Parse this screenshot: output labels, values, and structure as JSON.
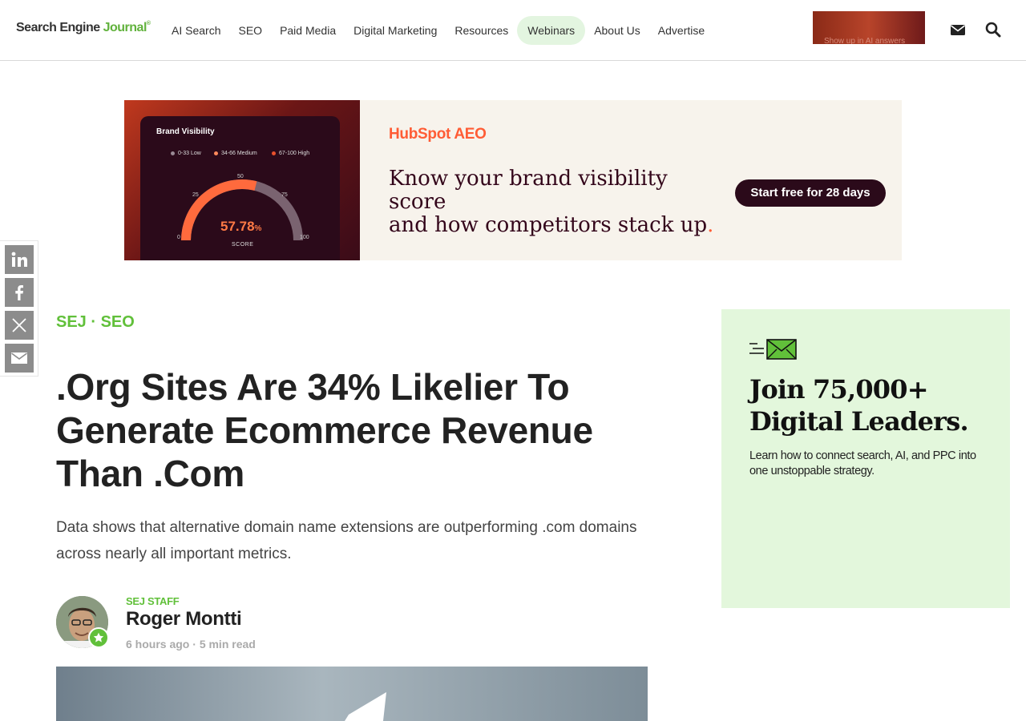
{
  "header": {
    "logo": {
      "part1": "Search Engine ",
      "part2": "Journal",
      "mark": "®"
    },
    "nav": [
      {
        "label": "AI Search"
      },
      {
        "label": "SEO"
      },
      {
        "label": "Paid Media"
      },
      {
        "label": "Digital Marketing"
      },
      {
        "label": "Resources"
      },
      {
        "label": "Webinars",
        "active": true
      },
      {
        "label": "About Us"
      },
      {
        "label": "Advertise"
      }
    ],
    "promo_text": "Show up in AI answers",
    "icons": [
      "mail-icon",
      "search-icon"
    ]
  },
  "banner_ad": {
    "dashboard": {
      "title": "Brand Visibility",
      "legend": [
        "0-33 Low",
        "34-66 Medium",
        "67-100 High"
      ],
      "ticks": [
        "0",
        "25",
        "50",
        "75",
        "100"
      ],
      "value": "57.78",
      "unit": "%",
      "sublabel": "SCORE",
      "gauge_fraction": 0.5778
    },
    "brand": "HubSpot",
    "brand_suffix": "AEO",
    "copy_line1": "Know your brand visibility score",
    "copy_line2": "and how competitors stack up",
    "copy_dot": ".",
    "cta": "Start free for 28 days",
    "colors": {
      "accent": "#ff5c35",
      "dark": "#2b0a1a"
    }
  },
  "social": [
    "linkedin-icon",
    "facebook-icon",
    "x-icon",
    "email-icon"
  ],
  "article": {
    "kicker": "SEJ · SEO",
    "title": ".Org Sites Are 34% Likelier To Generate Ecommerce Revenue Than .Com",
    "dek": "Data shows that alternative domain name extensions are outperforming .com domains across nearly all important metrics.",
    "author_role": "SEJ STAFF",
    "author": "Roger Montti",
    "posted": "6 hours ago",
    "sep": "·",
    "read_time": "5 min read"
  },
  "promo": {
    "title": "Join 75,000+ Digital Leaders.",
    "text": "Learn how to connect search, AI, and PPC into one unstoppable strategy.",
    "colors": {
      "background": "#e3f7dc",
      "accent": "#61c03a"
    }
  }
}
